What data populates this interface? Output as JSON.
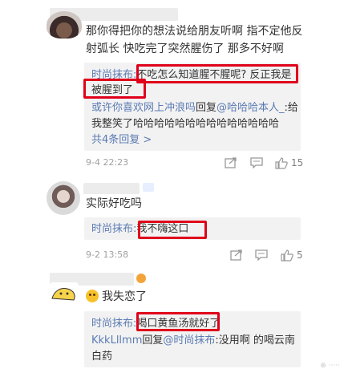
{
  "comments": [
    {
      "body": [
        "那你得把你的想法说给朋友听啊 指不定他反",
        "射弧长 快吃完了突然腥伤了 那多不好啊"
      ],
      "replies": [
        {
          "user": "时尚抹布:",
          "text": "不吃怎么知道腥不腥呢? 反正我是"
        },
        {
          "text": "被腥到了"
        }
      ],
      "reply2": {
        "user": "或许你喜欢网上冲浪吗",
        "mid": "回复",
        "mention": "@哈哈哈本人_",
        "text": ":给"
      },
      "reply2_cont": "我整笑了哈哈哈哈哈哈哈哈哈哈哈哈哈哈",
      "more": "共4条回复 >",
      "time": "9-4 22:23",
      "likes": "15"
    },
    {
      "body": "实际好吃吗",
      "reply": {
        "user": "时尚抹布:",
        "text": "我不嗨这口"
      },
      "time": "9-2 13:58",
      "likes": "5"
    },
    {
      "body": "我失恋了",
      "reply": {
        "user": "时尚抹布:",
        "text": "喝口黄鱼汤就好了"
      },
      "reply2": {
        "user": "KkkLllmm",
        "mid": "回复",
        "mention": "@时尚抹布",
        "text": ":没用啊 的喝云南"
      },
      "reply2_cont": "白药"
    }
  ],
  "icons": [
    "share-icon",
    "comment-icon",
    "like-icon"
  ],
  "colors": {
    "highlight": "#e0001b",
    "link": "#5b7bb3"
  }
}
